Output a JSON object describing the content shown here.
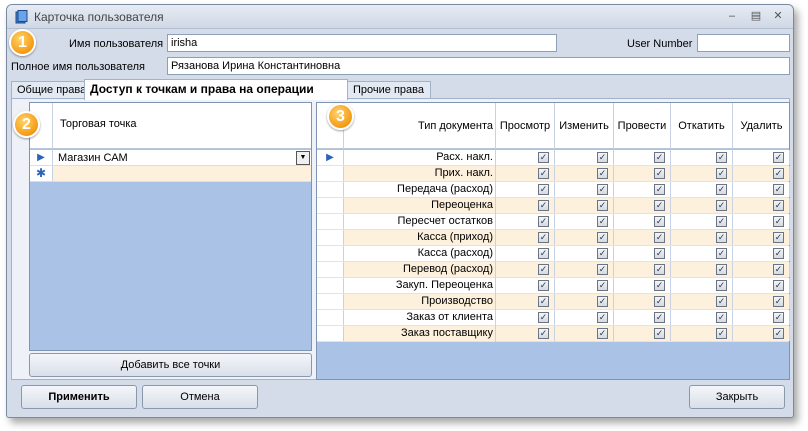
{
  "window": {
    "title": "Карточка пользователя"
  },
  "badges": [
    "1",
    "2",
    "3"
  ],
  "form": {
    "username_label": "Имя пользователя",
    "username_value": "irisha",
    "user_number_label": "User Number",
    "user_number_value": "",
    "fullname_label": "Полное имя пользователя",
    "fullname_value": "Рязанова Ирина Константиновна"
  },
  "tabs": [
    "Общие права",
    "Доступ к точкам и права на операции",
    "Прочие права"
  ],
  "left_grid": {
    "header": "Торговая точка",
    "rows": [
      "Магазин САМ"
    ],
    "add_button": "Добавить все точки"
  },
  "right_grid": {
    "columns": [
      "Тип документа",
      "Просмотр",
      "Изменить",
      "Провести",
      "Откатить",
      "Удалить"
    ],
    "rows": [
      "Расх. накл.",
      "Прих. накл.",
      "Передача (расход)",
      "Переоценка",
      "Пересчет остатков",
      "Касса (приход)",
      "Касса (расход)",
      "Перевод (расход)",
      "Закуп. Переоценка",
      "Производство",
      "Заказ от клиента",
      "Заказ поставщику"
    ]
  },
  "buttons": {
    "apply": "Применить",
    "cancel": "Отмена",
    "close": "Закрыть"
  },
  "colors": {
    "grid_bg": "#a9c2e6",
    "row_alt": "#fdf0dc",
    "badge": "#f59a14"
  }
}
